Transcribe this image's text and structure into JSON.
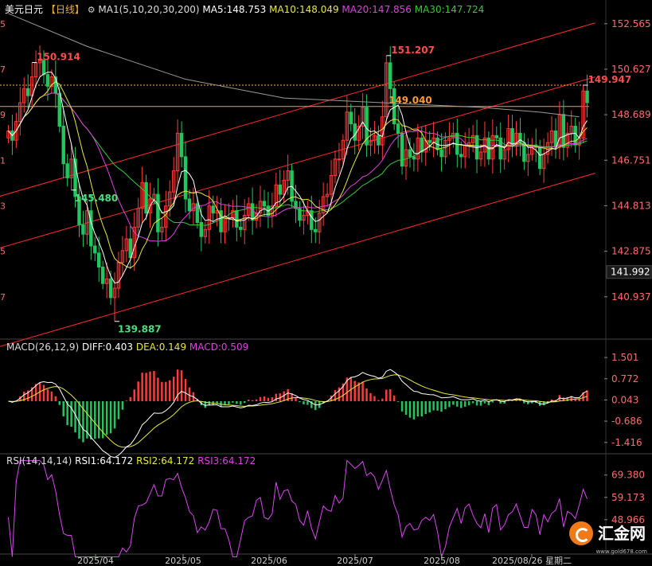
{
  "header": {
    "title": "美元日元",
    "period": "【日线】",
    "ma_label": "MA1(5,10,20,30,200)",
    "ma5": "MA5:148.753",
    "ma10": "MA10:148.049",
    "ma20": "MA20:147.856",
    "ma30": "MA30:147.724"
  },
  "macd_header": {
    "label": "MACD(26,12,9)",
    "diff": "DIFF:0.403",
    "dea": "DEA:0.149",
    "macd": "MACD:0.509"
  },
  "rsi_header": {
    "label": "RSI(14,14,14)",
    "rsi1": "RSI1:64.172",
    "rsi2": "RSI2:64.172",
    "rsi3": "RSI3:64.172"
  },
  "logo": {
    "text": "汇金网",
    "sub": "www.gold678.com"
  },
  "colors": {
    "up": "#ff3b3b",
    "down": "#22c55e",
    "ma5": "#ffffff",
    "ma10": "#e8e840",
    "ma20": "#e040e0",
    "ma30": "#33cc33",
    "ma200": "#9a9a9a",
    "channel": "#ff2a2a",
    "last_price_bg": "#1a1a1a"
  },
  "chart_data": {
    "type": "candlestick",
    "price_axis": {
      "ticks": [
        "152.565",
        "150.627",
        "148.689",
        "146.751",
        "144.813",
        "142.875",
        "140.937"
      ],
      "range": [
        139.2,
        153.1
      ],
      "last_price": "141.992"
    },
    "x_labels": [
      "2025/04",
      "2025/05",
      "2025/06",
      "2025/07",
      "2025/08",
      "2025/08/26 星期二"
    ],
    "annotations": [
      {
        "text": "151.207",
        "value": 151.207,
        "type": "high"
      },
      {
        "text": "150.914",
        "value": 150.914,
        "type": "high"
      },
      {
        "text": "149.947",
        "value": 149.947,
        "type": "high"
      },
      {
        "text": "149.040",
        "value": 149.04,
        "type": "level"
      },
      {
        "text": "145.480",
        "value": 145.48,
        "type": "low"
      },
      {
        "text": "139.887",
        "value": 139.887,
        "type": "low"
      }
    ],
    "macd_axis": {
      "ticks": [
        "1.501",
        "0.772",
        "0.043",
        "-0.686",
        "-1.416"
      ],
      "range": [
        -1.75,
        1.75
      ]
    },
    "rsi_axis": {
      "ticks": [
        "69.380",
        "59.173",
        "48.966"
      ],
      "range": [
        34,
        74
      ]
    },
    "closes": [
      148.0,
      147.6,
      148.4,
      149.2,
      149.8,
      149.5,
      150.3,
      150.9,
      151.0,
      150.4,
      149.9,
      150.3,
      149.6,
      148.2,
      146.6,
      146.0,
      146.8,
      145.2,
      144.0,
      143.6,
      144.6,
      143.1,
      142.8,
      142.2,
      141.5,
      141.7,
      140.9,
      141.3,
      142.4,
      142.9,
      143.4,
      142.6,
      143.9,
      144.7,
      145.8,
      144.5,
      145.1,
      145.3,
      143.7,
      143.9,
      144.8,
      145.4,
      146.3,
      147.9,
      146.9,
      145.1,
      144.6,
      144.9,
      144.1,
      143.5,
      143.8,
      144.8,
      144.5,
      144.6,
      143.7,
      144.3,
      144.3,
      144.6,
      143.9,
      143.8,
      144.4,
      144.9,
      144.2,
      144.5,
      145.0,
      144.8,
      144.4,
      144.8,
      145.7,
      145.3,
      145.9,
      146.3,
      145.0,
      144.7,
      144.2,
      144.4,
      144.6,
      143.8,
      143.7,
      144.5,
      145.2,
      145.3,
      146.1,
      146.8,
      146.8,
      147.6,
      148.8,
      148.3,
      147.6,
      148.2,
      149.0,
      147.4,
      147.6,
      147.8,
      147.4,
      148.6,
      150.9,
      149.8,
      148.3,
      147.9,
      146.5,
      147.2,
      146.9,
      146.8,
      147.7,
      147.1,
      147.6,
      147.5,
      147.7,
      147.2,
      146.9,
      147.6,
      147.7,
      147.9,
      147.0,
      146.9,
      147.4,
      147.5,
      147.8,
      146.8,
      147.1,
      147.7,
      146.8,
      147.8,
      147.7,
      146.8,
      147.2,
      148.1,
      147.4,
      147.9,
      147.5,
      146.7,
      147.0,
      147.4,
      147.3,
      146.4,
      147.0,
      147.5,
      148.0,
      147.3,
      148.7,
      147.3,
      147.9,
      148.2,
      147.4,
      147.7,
      149.7,
      149.2
    ],
    "ma200_points": [
      [
        0,
        153.0
      ],
      [
        20,
        151.6
      ],
      [
        45,
        150.2
      ],
      [
        70,
        149.4
      ],
      [
        95,
        149.2
      ],
      [
        120,
        149.0
      ],
      [
        135,
        148.8
      ],
      [
        145,
        148.6
      ]
    ],
    "channel_lines": [
      {
        "from": [
          0,
          145.2
        ],
        "to": [
          145,
          152.6
        ]
      },
      {
        "from": [
          0,
          143.0
        ],
        "to": [
          145,
          150.3
        ]
      },
      {
        "from": [
          0,
          138.8
        ],
        "to": [
          145,
          146.2
        ]
      }
    ],
    "level_lines": [
      {
        "value": 149.947,
        "style": "dotted",
        "color": "#ffaa33"
      },
      {
        "value": 149.04,
        "style": "solid",
        "color": "#ff9933"
      }
    ]
  }
}
